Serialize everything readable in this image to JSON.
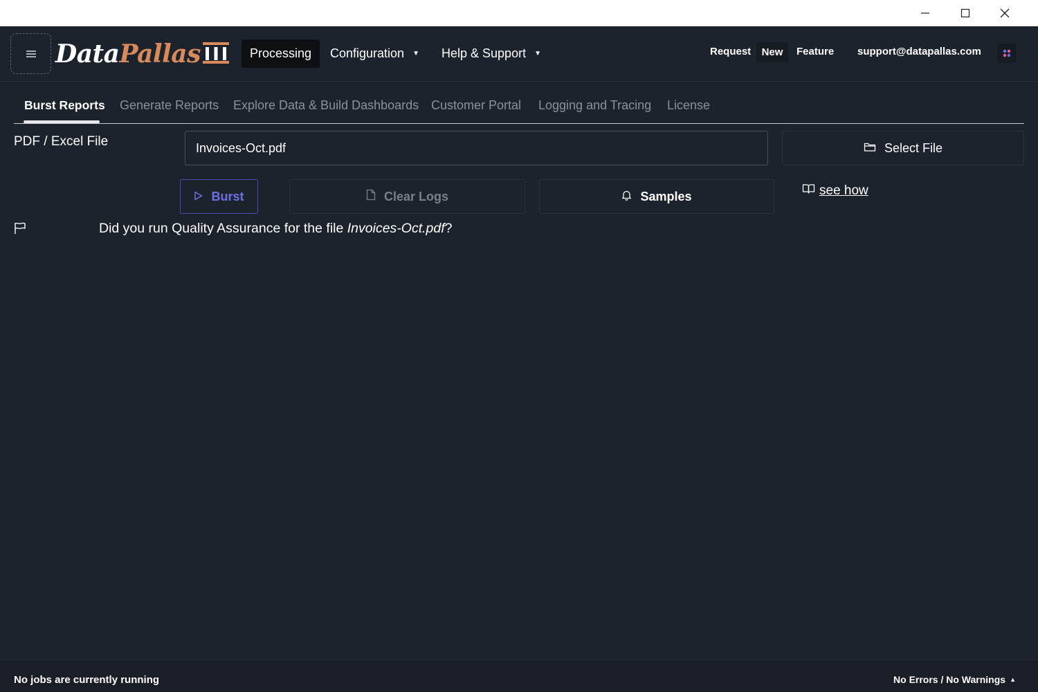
{
  "window": {
    "controls": [
      "minimize-icon",
      "maximize-icon",
      "close-icon"
    ]
  },
  "header": {
    "menu_icon": "hamburger-icon",
    "logo_part1": "Data",
    "logo_part2": "Pallas",
    "logo_icon": "pillars-icon",
    "nav": {
      "processing": "Processing",
      "configuration": "Configuration",
      "help": "Help & Support"
    },
    "request_label": "Request",
    "new_label": "New",
    "feature_label": "Feature",
    "support_email": "support@datapallas.com",
    "apps_icon": "apps-grid-icon"
  },
  "tabs": [
    {
      "label": "Burst Reports",
      "active": true
    },
    {
      "label": "Generate Reports"
    },
    {
      "label": "Explore Data & Build Dashboards"
    },
    {
      "label": "Customer Portal"
    },
    {
      "label": "Logging and Tracing"
    },
    {
      "label": "License"
    }
  ],
  "file": {
    "label": "PDF / Excel File",
    "value": "Invoices-Oct.pdf",
    "select_label": "Select File"
  },
  "actions": {
    "burst": "Burst",
    "clear_logs": "Clear Logs",
    "samples": "Samples",
    "see_how": "see how"
  },
  "qa": {
    "prefix": "Did you run Quality Assurance for the file ",
    "filename": "Invoices-Oct.pdf",
    "suffix": "?"
  },
  "status": {
    "left": "No jobs are currently running",
    "right": "No Errors / No Warnings"
  },
  "colors": {
    "background": "#1d232c",
    "accent": "#6e71e6",
    "logo_accent": "#d98a5a"
  }
}
